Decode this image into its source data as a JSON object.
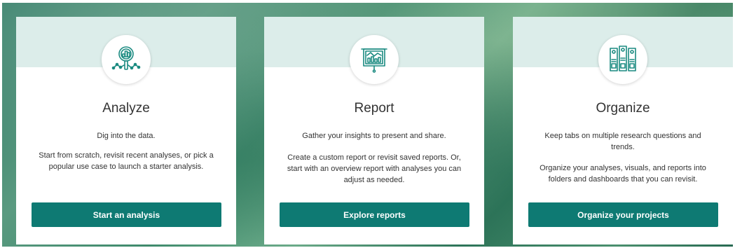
{
  "colors": {
    "accent": "#0e7a73",
    "card_header": "#dcedea",
    "icon_stroke": "#1a8a80"
  },
  "cards": [
    {
      "icon": "magnifier-chart-icon",
      "title": "Analyze",
      "subtitle": "Dig into the data.",
      "description": "Start from scratch, revisit recent analyses, or pick a popular use case to launch a starter analysis.",
      "button_label": "Start an analysis"
    },
    {
      "icon": "presentation-board-icon",
      "title": "Report",
      "subtitle": "Gather your insights to present and share.",
      "description": "Create a custom report or revisit saved reports. Or, start with an overview report with analyses you can adjust as needed.",
      "button_label": "Explore reports"
    },
    {
      "icon": "binders-icon",
      "title": "Organize",
      "subtitle": "Keep tabs on multiple research questions and trends.",
      "description": "Organize your analyses, visuals, and reports into folders and dashboards that you can revisit.",
      "button_label": "Organize your projects"
    }
  ]
}
